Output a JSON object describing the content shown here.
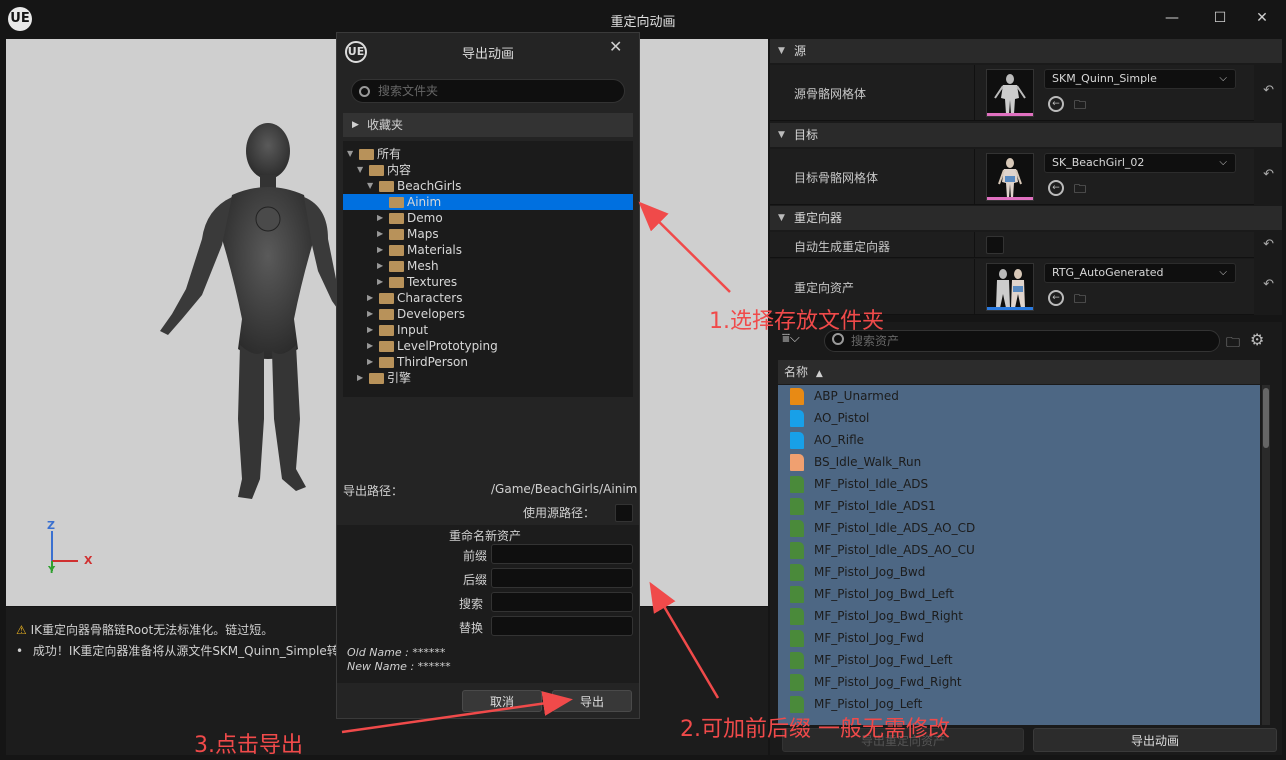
{
  "window": {
    "title": "重定向动画",
    "logo": "UE",
    "minimize": "—",
    "maximize": "☐",
    "close": "✕"
  },
  "viewport": {
    "axis_z": "Z",
    "axis_y": "Y",
    "axis_x": "X"
  },
  "messages": {
    "warning": "IK重定向器骨骼链Root无法标准化。链过短。",
    "success": "成功！IK重定向器准备将从源文件SKM_Quinn_Simple转"
  },
  "details": {
    "source_section": "源",
    "source_label": "源骨骼网格体",
    "source_value": "SKM_Quinn_Simple",
    "target_section": "目标",
    "target_label": "目标骨骼网格体",
    "target_value": "SK_BeachGirl_02",
    "retargeter_section": "重定向器",
    "auto_label": "自动生成重定向器",
    "asset_label": "重定向资产",
    "asset_value": "RTG_AutoGenerated"
  },
  "content_browser": {
    "search_placeholder": "搜索资产",
    "column_name": "名称",
    "sort_icon": "▲",
    "assets": [
      {
        "name": "ABP_Unarmed",
        "color": "#e88a14"
      },
      {
        "name": "AO_Pistol",
        "color": "#18a0e8"
      },
      {
        "name": "AO_Rifle",
        "color": "#18a0e8"
      },
      {
        "name": "BS_Idle_Walk_Run",
        "color": "#f0a070"
      },
      {
        "name": "MF_Pistol_Idle_ADS",
        "color": "#4a8a3a"
      },
      {
        "name": "MF_Pistol_Idle_ADS1",
        "color": "#4a8a3a"
      },
      {
        "name": "MF_Pistol_Idle_ADS_AO_CD",
        "color": "#4a8a3a"
      },
      {
        "name": "MF_Pistol_Idle_ADS_AO_CU",
        "color": "#4a8a3a"
      },
      {
        "name": "MF_Pistol_Jog_Bwd",
        "color": "#4a8a3a"
      },
      {
        "name": "MF_Pistol_Jog_Bwd_Left",
        "color": "#4a8a3a"
      },
      {
        "name": "MF_Pistol_Jog_Bwd_Right",
        "color": "#4a8a3a"
      },
      {
        "name": "MF_Pistol_Jog_Fwd",
        "color": "#4a8a3a"
      },
      {
        "name": "MF_Pistol_Jog_Fwd_Left",
        "color": "#4a8a3a"
      },
      {
        "name": "MF_Pistol_Jog_Fwd_Right",
        "color": "#4a8a3a"
      },
      {
        "name": "MF_Pistol_Jog_Left",
        "color": "#4a8a3a"
      }
    ],
    "export_assets_button": "导出重定向资产",
    "export_anim_button": "导出动画"
  },
  "dialog": {
    "title": "导出动画",
    "search_placeholder": "搜索文件夹",
    "favorites": "收藏夹",
    "tree": [
      {
        "label": "所有",
        "depth": 0,
        "expanded": true
      },
      {
        "label": "内容",
        "depth": 1,
        "expanded": true
      },
      {
        "label": "BeachGirls",
        "depth": 2,
        "expanded": true
      },
      {
        "label": "Ainim",
        "depth": 3,
        "expanded": false,
        "selected": true
      },
      {
        "label": "Demo",
        "depth": 3,
        "expanded": false
      },
      {
        "label": "Maps",
        "depth": 3,
        "expanded": false
      },
      {
        "label": "Materials",
        "depth": 3,
        "expanded": false
      },
      {
        "label": "Mesh",
        "depth": 3,
        "expanded": false
      },
      {
        "label": "Textures",
        "depth": 3,
        "expanded": false
      },
      {
        "label": "Characters",
        "depth": 2,
        "expanded": false
      },
      {
        "label": "Developers",
        "depth": 2,
        "expanded": false
      },
      {
        "label": "Input",
        "depth": 2,
        "expanded": false
      },
      {
        "label": "LevelPrototyping",
        "depth": 2,
        "expanded": false
      },
      {
        "label": "ThirdPerson",
        "depth": 2,
        "expanded": false
      },
      {
        "label": "引擎",
        "depth": 1,
        "expanded": false
      }
    ],
    "export_path_label": "导出路径：",
    "export_path_value": "/Game/BeachGirls/Ainim",
    "use_source_label": "使用源路径：",
    "rename_header": "重命名新资产",
    "prefix_label": "前缀",
    "suffix_label": "后缀",
    "search_label": "搜索",
    "replace_label": "替换",
    "old_name": "Old Name : ******",
    "new_name": "New Name : ******",
    "cancel_button": "取消",
    "export_button": "导出"
  },
  "annotations": {
    "step1": "1.选择存放文件夹",
    "step2": "2.可加前后缀 一般无需修改",
    "step3": "3.点击导出",
    "color": "#f04a4a"
  }
}
